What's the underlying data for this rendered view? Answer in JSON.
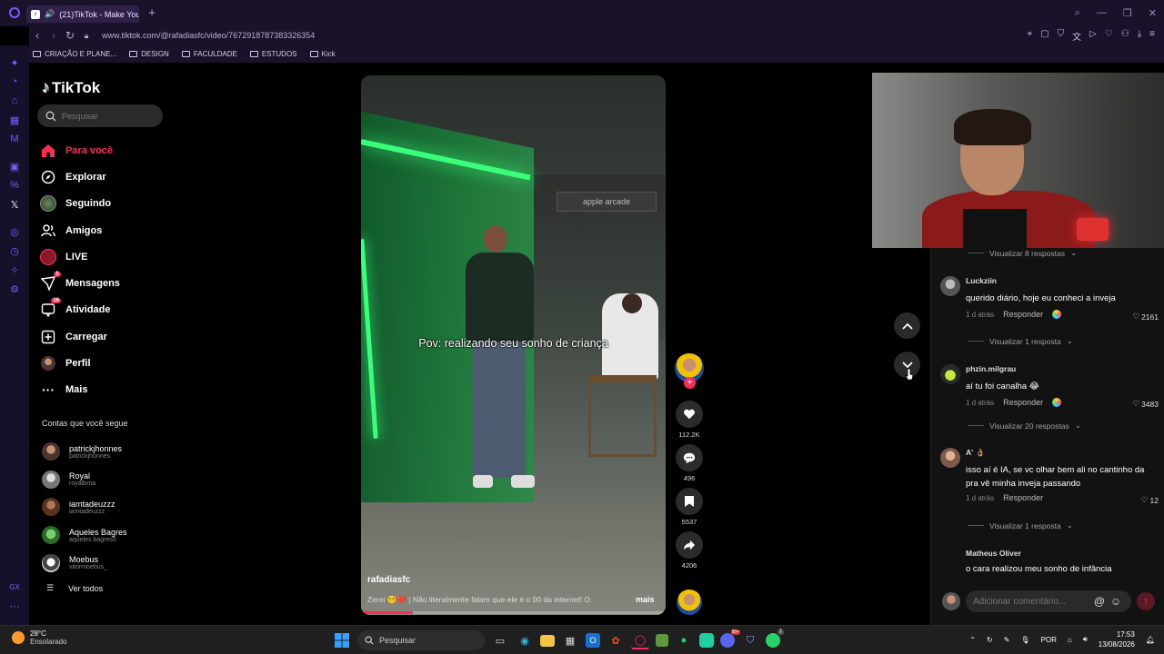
{
  "browser": {
    "tab_title": "(21)TikTok - Make Your",
    "url": "www.tiktok.com/@rafadiasfc/video/7672918787383326354",
    "bookmarks": [
      "CRIAÇÃO E PLANE...",
      "DESIGN",
      "FACULDADE",
      "ESTUDOS",
      "Kick"
    ]
  },
  "sidebar": {
    "logo": "TikTok",
    "search_placeholder": "Pesquisar",
    "nav": [
      {
        "label": "Para você",
        "icon": "home-icon",
        "active": true
      },
      {
        "label": "Explorar",
        "icon": "compass-icon"
      },
      {
        "label": "Seguindo",
        "icon": "following-icon"
      },
      {
        "label": "Amigos",
        "icon": "friends-icon"
      },
      {
        "label": "LIVE",
        "icon": "live-icon"
      },
      {
        "label": "Mensagens",
        "icon": "message-icon",
        "badge": "5"
      },
      {
        "label": "Atividade",
        "icon": "activity-icon",
        "badge": "16"
      },
      {
        "label": "Carregar",
        "icon": "upload-icon"
      },
      {
        "label": "Perfil",
        "icon": "profile-icon"
      },
      {
        "label": "Mais",
        "icon": "more-icon"
      }
    ],
    "following_header": "Contas que você segue",
    "following": [
      {
        "name": "patrickjhonnes",
        "handle": "patrickjhonnes"
      },
      {
        "name": "Royal",
        "handle": "royalbrna"
      },
      {
        "name": "iamtadeuzzz",
        "handle": "iamtadeuzzz"
      },
      {
        "name": "Aqueles Bagres",
        "handle": "aqueles.bagres5"
      },
      {
        "name": "Moebus",
        "handle": "vitormoebus_"
      }
    ],
    "see_all": "Ver todos"
  },
  "video": {
    "caption": "Pov: realizando seu sonho de criança",
    "username": "rafadiasfc",
    "description": "Zerei 😵‍💫❤️ | Não literalmente falam que ele é o 00 da internet! O",
    "more_label": "mais",
    "progress": 0.17,
    "banner_text": "apple arcade"
  },
  "actions": {
    "likes": "112.2K",
    "comments": "496",
    "saves": "5537",
    "shares": "4206"
  },
  "comments": {
    "view_replies": [
      "Visualizar 8 respostas",
      "Visualizar 1 resposta",
      "Visualizar 20 respostas",
      "Visualizar 1 resposta"
    ],
    "items": [
      {
        "user": "Luckziin",
        "text": "querido diário, hoje eu conheci a inveja",
        "time": "1 d atrás",
        "reply": "Responder",
        "likes": "2161"
      },
      {
        "user": "phzin.milgrau",
        "text": "aí tu foi canalha 😂",
        "time": "1 d atrás",
        "reply": "Responder",
        "likes": "3483"
      },
      {
        "user": "A' 👌🏽",
        "text": "isso aí é IA, se vc olhar bem ali no cantinho da pra vê minha inveja passando",
        "time": "1 d atrás",
        "reply": "Responder",
        "likes": "12"
      },
      {
        "user": "Matheus Oliver",
        "text": "o cara realizou meu sonho de infância"
      }
    ],
    "input_placeholder": "Adicionar comentário..."
  },
  "taskbar": {
    "weather_temp": "28°C",
    "weather_desc": "Ensolarado",
    "search_label": "Pesquisar",
    "lang": "POR",
    "time": "17:53",
    "date": "13/08/2026",
    "discord_badge": "99+",
    "whatsapp_badge": "7"
  },
  "colors": {
    "accent": "#fe2c55",
    "opera_purple": "#7a5cff"
  }
}
